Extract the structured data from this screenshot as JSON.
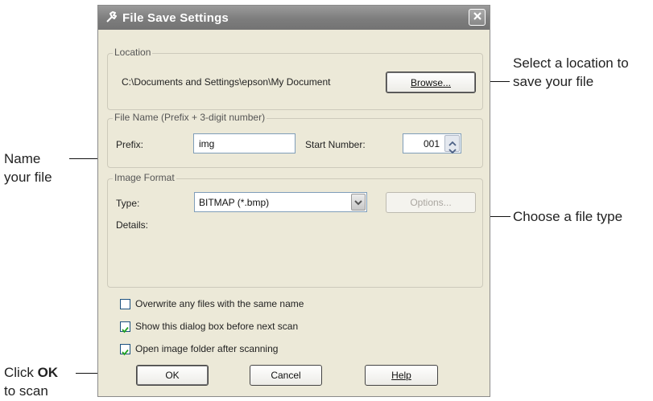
{
  "dialog": {
    "title": "File Save Settings",
    "icon": "wrench-icon",
    "close_icon": "close-icon"
  },
  "location": {
    "legend": "Location",
    "path": "C:\\Documents and Settings\\epson\\My Document",
    "browse_label": "Browse...",
    "browse_mnemonic": "B"
  },
  "file_name": {
    "legend": "File Name (Prefix + 3-digit number)",
    "prefix_label": "Prefix:",
    "prefix_value": "img",
    "start_number_label": "Start Number:",
    "start_number_value": "001"
  },
  "image_format": {
    "legend": "Image Format",
    "type_label": "Type:",
    "type_value": "BITMAP (*.bmp)",
    "options_label": "Options...",
    "details_label": "Details:"
  },
  "checkboxes": [
    {
      "label": "Overwrite any files with the same name",
      "checked": false
    },
    {
      "label": "Show this dialog box before next scan",
      "checked": true
    },
    {
      "label": "Open image folder after scanning",
      "checked": true
    }
  ],
  "buttons": {
    "ok": "OK",
    "cancel": "Cancel",
    "help": "Help"
  },
  "callouts": {
    "location": "Select a location to save your file",
    "name": "Name your file",
    "type": "Choose a file type",
    "ok_prefix": "Click",
    "ok_bold": "OK",
    "ok_suffix": "to scan"
  },
  "colors": {
    "titlebar": "#808080",
    "dialog_bg": "#ece9d8",
    "checkbox_border": "#1c5180",
    "checkmark": "#21a121"
  }
}
